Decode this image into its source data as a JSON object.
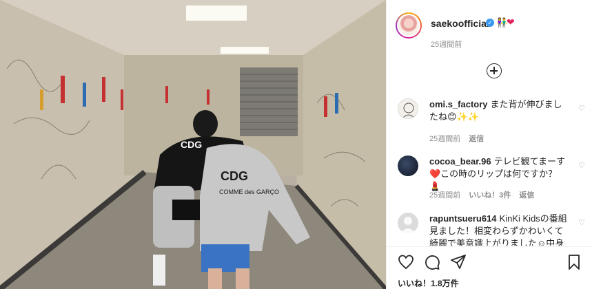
{
  "post": {
    "username": "saekoofficial",
    "verified_symbol": "✓",
    "emoji_couple": "👫",
    "emoji_heart": "❤",
    "time_ago": "25週間前"
  },
  "comments": [
    {
      "username": "omi.s_factory",
      "text": "また背が伸びましたね😊✨✨",
      "time": "25週間前",
      "reply": "返信",
      "likes": ""
    },
    {
      "username": "cocoa_bear.96",
      "text": "テレビ観てまーす❤️この時のリップは何ですか？💄",
      "time": "25週間前",
      "likes": "いいね！3件",
      "reply": "返信"
    },
    {
      "username": "rapuntsueru614",
      "text": "KinKi Kidsの番組見ました！相変わらずかわいくて綺麗で美意識上がりました☺中身",
      "time": "",
      "reply": "",
      "likes": ""
    }
  ],
  "actions": {
    "likes_text": "いいね！1.8万件",
    "like_icon": "heart-outline",
    "comment_icon": "speech-bubble",
    "share_icon": "paper-plane",
    "save_icon": "bookmark"
  },
  "photo": {
    "hoodie_left_text": "CDG",
    "hoodie_left_sub": "COMME des GARÇONS",
    "hoodie_right_text": "CDG",
    "hoodie_right_sub": "COMME des GARÇO"
  },
  "colors": {
    "verified": "#3897f0",
    "meta_text": "#8e8e8e",
    "primary_text": "#262626"
  }
}
